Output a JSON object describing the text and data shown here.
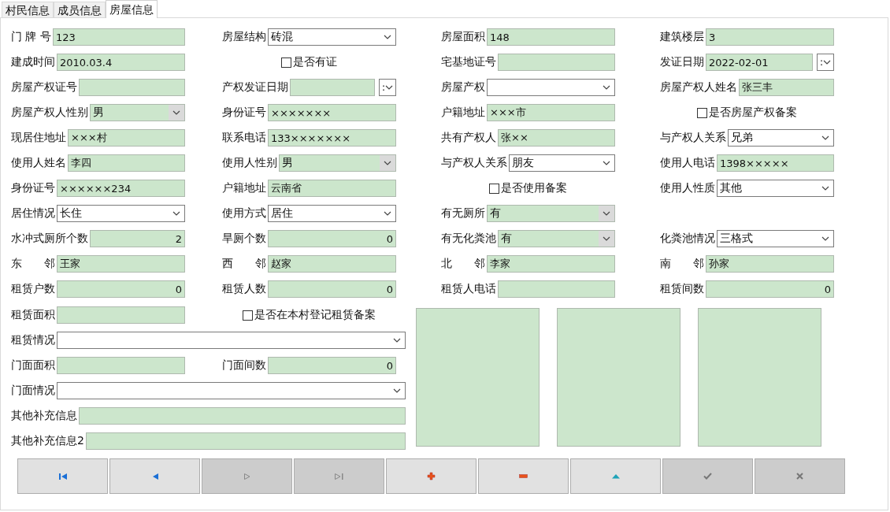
{
  "tabs": [
    {
      "label": "村民信息",
      "selected": false
    },
    {
      "label": "成员信息",
      "selected": false
    },
    {
      "label": "房屋信息",
      "selected": true
    }
  ],
  "top_rows": [
    [
      {
        "kind": "text",
        "label": "门 牌 号",
        "value": "123"
      },
      {
        "kind": "combo",
        "label": "房屋结构",
        "value": "砖混",
        "disabled": false
      },
      {
        "kind": "text",
        "label": "房屋面积",
        "value": "148"
      },
      {
        "kind": "text",
        "label": "建筑楼层",
        "value": "3"
      }
    ],
    [
      {
        "kind": "text",
        "label": "建成时间",
        "value": "2010.03.4"
      },
      {
        "kind": "check",
        "label": "是否有证",
        "checked": false
      },
      {
        "kind": "text",
        "label": "宅基地证号"
      },
      {
        "kind": "date",
        "label": "发证日期",
        "value": "2022-02-01",
        "picker": ":"
      }
    ],
    [
      {
        "kind": "text",
        "label": "房屋产权证号"
      },
      {
        "kind": "date",
        "label": "产权发证日期",
        "picker": ":"
      },
      {
        "kind": "combo",
        "label": "房屋产权",
        "disabled": false
      },
      {
        "kind": "text",
        "label": "房屋产权人姓名",
        "value": "张三丰"
      }
    ],
    [
      {
        "kind": "combo",
        "label": "房屋产权人性别",
        "value": "男",
        "disabled": true
      },
      {
        "kind": "text",
        "label": "身份证号",
        "value": "×××××××"
      },
      {
        "kind": "text",
        "label": "户籍地址",
        "value": "×××市"
      },
      {
        "kind": "check",
        "label": "是否房屋产权备案",
        "checked": false
      }
    ],
    [
      {
        "kind": "text",
        "label": "现居住地址",
        "value": "×××村"
      },
      {
        "kind": "text",
        "label": "联系电话",
        "value": "133×××××××"
      },
      {
        "kind": "text",
        "label": "共有产权人",
        "value": "张××"
      },
      {
        "kind": "combo",
        "label": "与产权人关系",
        "value": "兄弟",
        "disabled": false
      }
    ],
    [
      {
        "kind": "text",
        "label": "使用人姓名",
        "value": "李四"
      },
      {
        "kind": "combo",
        "label": "使用人性别",
        "value": "男",
        "disabled": true
      },
      {
        "kind": "combo",
        "label": "与产权人关系",
        "value": "朋友",
        "disabled": false
      },
      {
        "kind": "text",
        "label": "使用人电话",
        "value": "1398×××××"
      }
    ],
    [
      {
        "kind": "text",
        "label": "身份证号",
        "value": "××××××234"
      },
      {
        "kind": "text",
        "label": "户籍地址",
        "value": "云南省"
      },
      {
        "kind": "check",
        "label": "是否使用备案",
        "checked": false
      },
      {
        "kind": "combo",
        "label": "使用人性质",
        "value": "其他",
        "disabled": false
      }
    ],
    [
      {
        "kind": "combo",
        "label": "居住情况",
        "value": "长住",
        "disabled": false
      },
      {
        "kind": "combo",
        "label": "使用方式",
        "value": "居住",
        "disabled": false
      },
      {
        "kind": "combo",
        "label": "有无厕所",
        "value": "有",
        "disabled": true
      }
    ],
    [
      {
        "kind": "number",
        "label": "水冲式厕所个数",
        "value": "2"
      },
      {
        "kind": "number",
        "label": "旱厕个数",
        "value": "0"
      },
      {
        "kind": "combo",
        "label": "有无化粪池",
        "value": "有",
        "disabled": true
      },
      {
        "kind": "combo",
        "label": "化粪池情况",
        "value": "三格式",
        "disabled": false
      }
    ],
    [
      {
        "kind": "text",
        "label": "东　　邻",
        "value": "王家"
      },
      {
        "kind": "text",
        "label": "西　　邻",
        "value": "赵家"
      },
      {
        "kind": "text",
        "label": "北　　邻",
        "value": "李家"
      },
      {
        "kind": "text",
        "label": "南　　邻",
        "value": "孙家"
      }
    ],
    [
      {
        "kind": "number",
        "label": "租赁户数",
        "value": "0"
      },
      {
        "kind": "number",
        "label": "租赁人数",
        "value": "0"
      },
      {
        "kind": "text",
        "label": "租赁人电话"
      },
      {
        "kind": "number",
        "label": "租赁间数",
        "value": "0"
      }
    ]
  ],
  "lower_rows": [
    [
      {
        "kind": "text",
        "label": "租赁面积"
      },
      {
        "kind": "check",
        "label": "是否在本村登记租赁备案",
        "checked": false
      }
    ],
    [
      {
        "kind": "wide_combo",
        "label": "租赁情况",
        "disabled": false
      }
    ],
    [
      {
        "kind": "text",
        "label": "门面面积"
      },
      {
        "kind": "number",
        "label": "门面间数",
        "value": "0"
      }
    ],
    [
      {
        "kind": "wide_combo",
        "label": "门面情况",
        "disabled": false
      }
    ],
    [
      {
        "kind": "wide_text",
        "label": "其他补充信息"
      }
    ],
    [
      {
        "kind": "wide_text",
        "label": "其他补充信息2"
      }
    ]
  ],
  "photos": [
    {
      "kind": "empty"
    },
    {
      "kind": "empty"
    },
    {
      "kind": "empty"
    }
  ],
  "buttons": [
    {
      "kind": "first",
      "disabled": false
    },
    {
      "kind": "prev",
      "disabled": false
    },
    {
      "kind": "next",
      "disabled": true
    },
    {
      "kind": "last",
      "disabled": true
    },
    {
      "kind": "add",
      "disabled": false
    },
    {
      "kind": "remove",
      "disabled": false
    },
    {
      "kind": "up",
      "disabled": false
    },
    {
      "kind": "check",
      "disabled": true
    },
    {
      "kind": "cross",
      "disabled": true
    }
  ]
}
